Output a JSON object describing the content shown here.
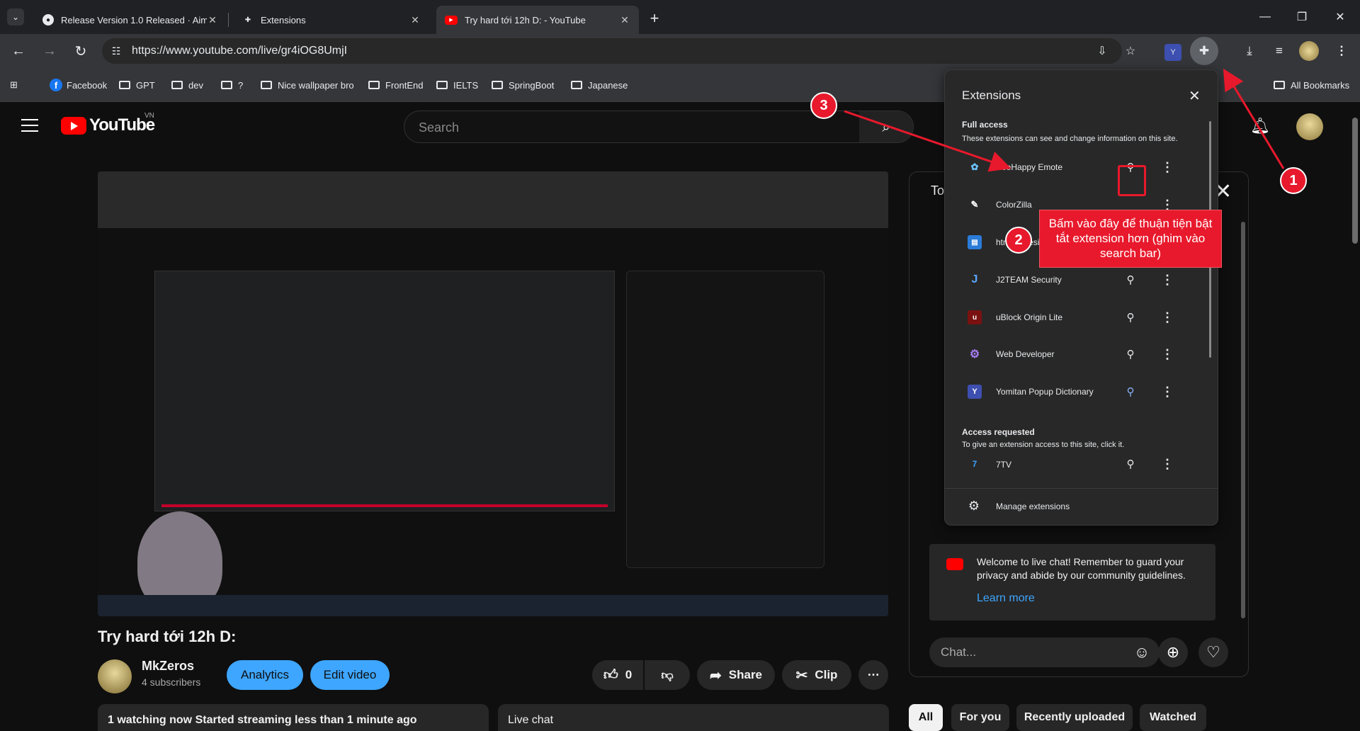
{
  "browser": {
    "tabs": [
      {
        "title": "Release Version 1.0 Released · AimKey",
        "active": false
      },
      {
        "title": "Extensions",
        "active": false
      },
      {
        "title": "Try hard tới 12h D: - YouTube",
        "active": true
      }
    ],
    "url": "https://www.youtube.com/live/gr4iOG8UmjI",
    "bookmarks": [
      "Facebook",
      "GPT",
      "dev",
      "?",
      "Nice wallpaper bro",
      "FrontEnd",
      "IELTS",
      "SpringBoot",
      "Japanese"
    ],
    "all_bookmarks": "All Bookmarks"
  },
  "youtube": {
    "logo_text": "YouTube",
    "region": "VN",
    "search_placeholder": "Search",
    "video_title": "Try hard tới 12h D:",
    "channel_name": "MkZeros",
    "subscribers": "4 subscribers",
    "analytics_label": "Analytics",
    "edit_video_label": "Edit video",
    "like_count": "0",
    "share_label": "Share",
    "clip_label": "Clip",
    "info_text": "1 watching now  Started streaming less than 1 minute ago",
    "live_chat_label": "Live chat",
    "chat_header": "To",
    "welcome_text": "Welcome to live chat! Remember to guard your privacy and abide by our community guidelines.",
    "learn_more": "Learn more",
    "chat_placeholder": "Chat...",
    "chips": [
      "All",
      "For you",
      "Recently uploaded",
      "Watched"
    ]
  },
  "extensions": {
    "title": "Extensions",
    "full_access_heading": "Full access",
    "full_access_desc": "These extensions can see and change information on this site.",
    "items": [
      {
        "name": "BeeHappy Emote",
        "icon": "bee-icon",
        "pinned": false
      },
      {
        "name": "ColorZilla",
        "icon": "eyedropper-icon",
        "pinned": false
      },
      {
        "name": "html.to.design",
        "icon": "html-to-design-icon",
        "pinned": false
      },
      {
        "name": "J2TEAM Security",
        "icon": "j2team-icon",
        "pinned": false
      },
      {
        "name": "uBlock Origin Lite",
        "icon": "ublock-icon",
        "pinned": false
      },
      {
        "name": "Web Developer",
        "icon": "gear-icon",
        "pinned": false
      },
      {
        "name": "Yomitan Popup Dictionary",
        "icon": "yomitan-icon",
        "pinned": true
      }
    ],
    "access_requested_heading": "Access requested",
    "access_requested_desc": "To give an extension access to this site, click it.",
    "requested_items": [
      {
        "name": "7TV",
        "icon": "7tv-icon"
      }
    ],
    "manage_label": "Manage extensions"
  },
  "annotations": {
    "badge1": "1",
    "badge2": "2",
    "badge3": "3",
    "note": "Bấm vào đây để thuận tiện bật tắt extension hơn (ghim vào search bar)",
    "color": "#e8192c"
  }
}
